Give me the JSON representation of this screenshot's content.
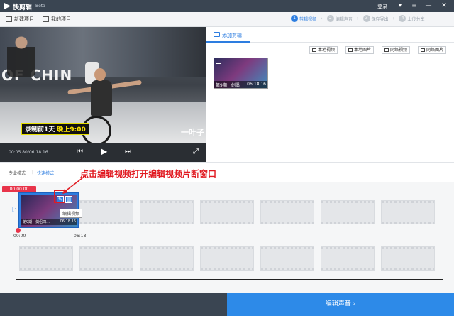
{
  "app": {
    "name": "快剪辑",
    "beta": "Beta",
    "login": "登录"
  },
  "toolbar": {
    "new_project": "新建项目",
    "my_projects": "我的项目"
  },
  "steps": [
    {
      "num": "1",
      "label": "剪辑视频",
      "active": true
    },
    {
      "num": "2",
      "label": "编辑声音",
      "active": false
    },
    {
      "num": "3",
      "label": "保存导出",
      "active": false
    },
    {
      "num": "4",
      "label": "上传分享",
      "active": false
    }
  ],
  "preview": {
    "time": "00:05.80/06:18.16",
    "caption_left": "录制前1天",
    "caption_right": "晚上9:00",
    "logo_text": "一叶子",
    "bg_text": "OF CHIN"
  },
  "right_panel": {
    "tab_label": "添加剪辑",
    "sources": [
      "本地视频",
      "本地图片",
      "网络视频",
      "网络图片"
    ],
    "thumb": {
      "title": "第9期：剑侣四...",
      "duration": "06:18.16"
    }
  },
  "modes": {
    "pro": "专业模式",
    "fast": "快速模式"
  },
  "annotation": "点击编辑视频打开编辑视频片断窗口",
  "timeline": {
    "playhead_time": "00:00.00",
    "clip": {
      "title": "第9期：剑侣四...",
      "duration": "06:18.16"
    },
    "tooltip": "编辑视频",
    "ticks": [
      "00:00",
      "06:18"
    ]
  },
  "footer": {
    "next_label": "编辑声音 ›"
  },
  "colors": {
    "accent": "#2d7de0",
    "title_bar": "#3a4552",
    "annotation_red": "#e11b22",
    "playhead": "#e8344a"
  }
}
